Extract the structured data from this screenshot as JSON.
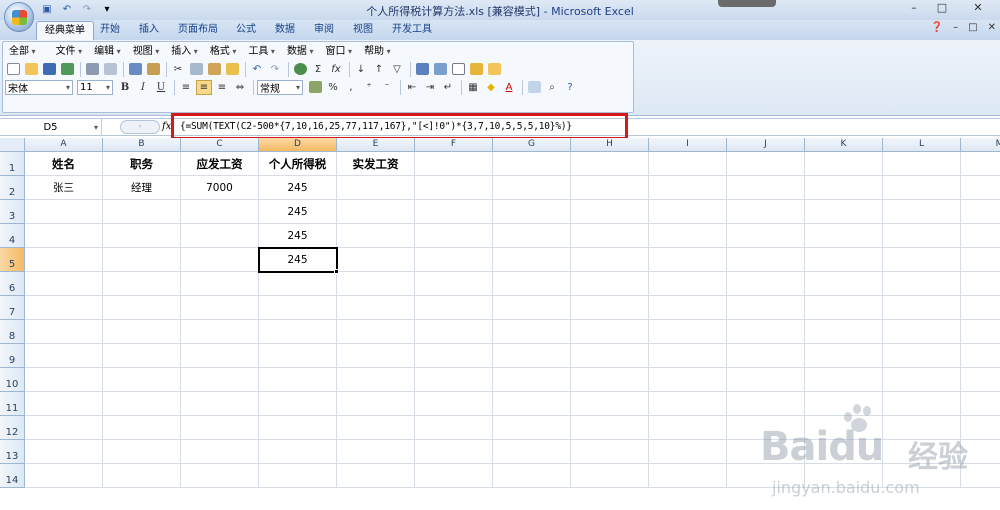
{
  "window": {
    "title": "个人所得税计算方法.xls",
    "mode": "[兼容模式]",
    "app": "- Microsoft Excel",
    "min": "–",
    "max": "□",
    "close": "✕"
  },
  "ribbon_tabs": [
    "经典菜单",
    "开始",
    "插入",
    "页面布局",
    "公式",
    "数据",
    "审阅",
    "视图",
    "开发工具"
  ],
  "classic_menus": [
    "全部",
    "文件",
    "编辑",
    "视图",
    "插入",
    "格式",
    "工具",
    "数据",
    "窗口",
    "帮助"
  ],
  "font": {
    "name": "宋体",
    "size": "11",
    "number_format": "常规"
  },
  "format_buttons": {
    "bold": "B",
    "italic": "I",
    "underline": "U",
    "font_color": "A",
    "percent": "%",
    "comma": ",",
    "sigma": "Σ",
    "fx_btn": "fx"
  },
  "formula_bar": {
    "name_box": "D5",
    "fx": "fx",
    "formula": "{=SUM(TEXT(C2-500*{7,10,16,25,77,117,167},\"[<]!0\")*{3,7,10,5,5,5,10}%)}"
  },
  "columns": [
    "A",
    "B",
    "C",
    "D",
    "E",
    "F",
    "G",
    "H",
    "I",
    "J",
    "K",
    "L",
    "M"
  ],
  "rows": [
    "1",
    "2",
    "3",
    "4",
    "5",
    "6",
    "7",
    "8",
    "9",
    "10",
    "11",
    "12",
    "13",
    "14"
  ],
  "cells": {
    "A1": "姓名",
    "B1": "职务",
    "C1": "应发工资",
    "D1": "个人所得税",
    "E1": "实发工资",
    "A2": "张三",
    "B2": "经理",
    "C2": "7000",
    "D2": "245",
    "D3": "245",
    "D4": "245",
    "D5": "245"
  },
  "selected_cell": "D5",
  "watermark": {
    "brand": "Bai",
    "brand2": "du",
    "cn": "经验",
    "url": "jingyan.baidu.com"
  },
  "colors": {
    "accent": "#f4b963",
    "highlight": "#d5191b"
  }
}
